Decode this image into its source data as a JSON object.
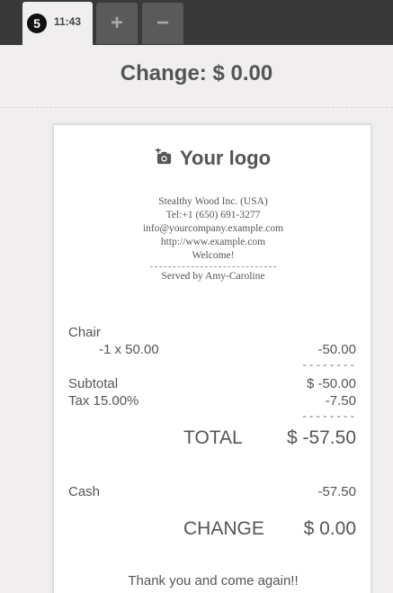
{
  "order_tab": {
    "number": "5",
    "time": "11:43"
  },
  "tab_actions": {
    "add": "+",
    "remove": "−"
  },
  "header": {
    "change": "Change: $ 0.00"
  },
  "receipt": {
    "logo_text": "Your logo",
    "company_lines": [
      "Stealthy Wood Inc. (USA)",
      "Tel:+1 (650) 691-3277",
      "info@yourcompany.example.com",
      "http://www.example.com",
      "Welcome!"
    ],
    "served_by": "Served by Amy-Caroline",
    "lines": [
      {
        "product": "Chair",
        "qty_price": "-1 x 50.00",
        "amount": "-50.00"
      }
    ],
    "separator": "--------",
    "subtotal": {
      "label": "Subtotal",
      "value": "$ -50.00"
    },
    "tax": {
      "label": "Tax 15.00%",
      "value": "-7.50"
    },
    "total": {
      "label": "TOTAL",
      "value": "$ -57.50"
    },
    "payment": {
      "label": "Cash",
      "value": "-57.50"
    },
    "change": {
      "label": "CHANGE",
      "value": "$ 0.00"
    },
    "footer": "Thank you and come again!!"
  }
}
